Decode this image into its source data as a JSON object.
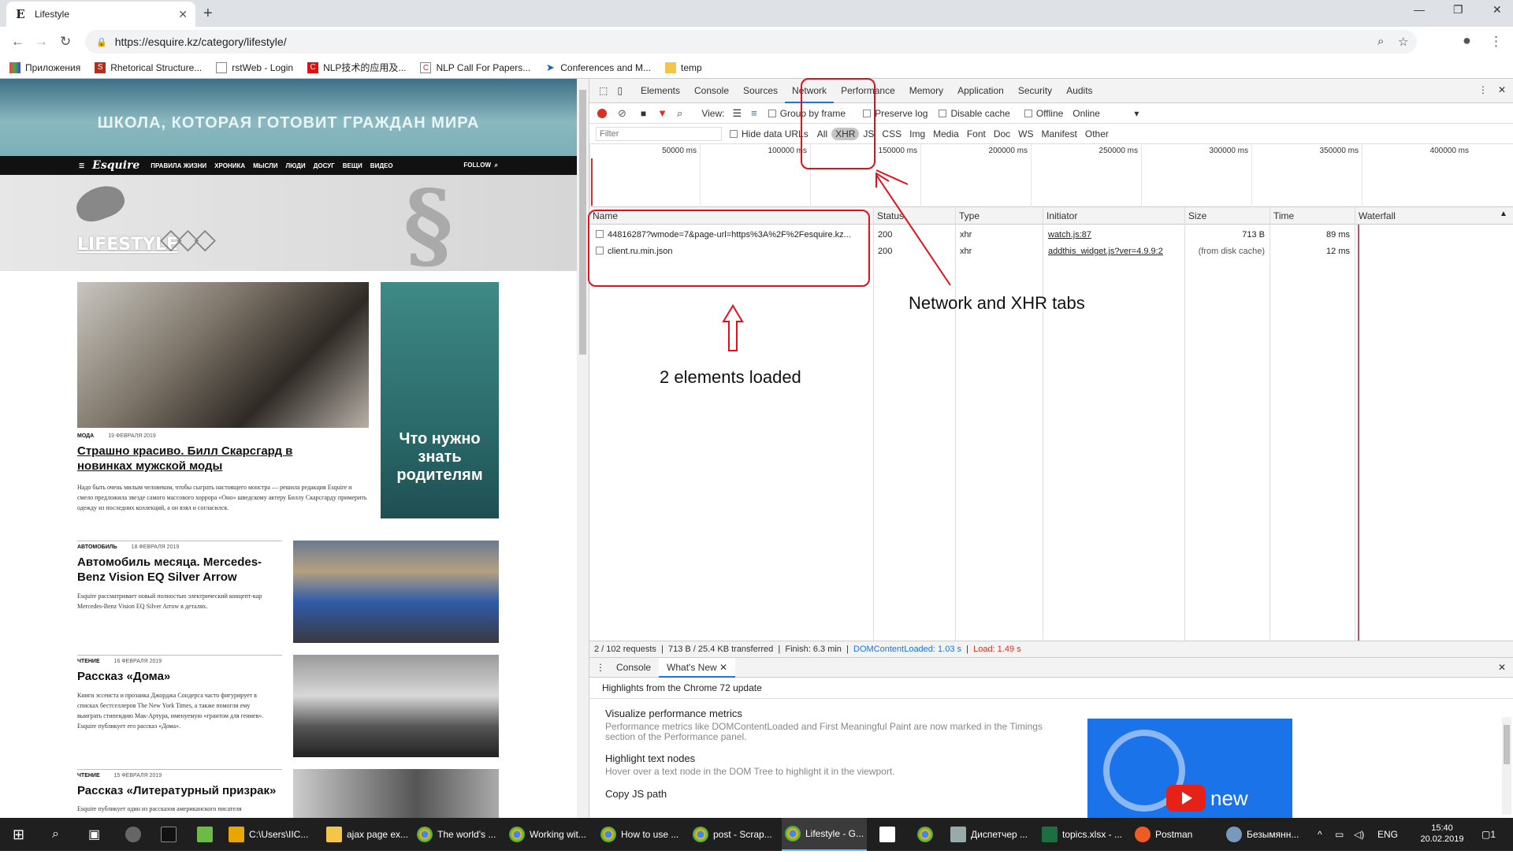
{
  "browser": {
    "tab_title": "Lifestyle",
    "tab_icon": "E",
    "url": "https://esquire.kz/category/lifestyle/",
    "bookmarks": [
      "Приложения",
      "Rhetorical Structure...",
      "rstWeb - Login",
      "NLP技术的应用及...",
      "NLP Call For Papers...",
      "Conferences and M...",
      "temp"
    ]
  },
  "page": {
    "banner_text": "ШКОЛА, КОТОРАЯ ГОТОВИТ ГРАЖДАН МИРА",
    "nav_logo": "Esquire",
    "nav_items": [
      "ПРАВИЛА ЖИЗНИ",
      "ХРОНИКА",
      "МЫСЛИ",
      "ЛЮДИ",
      "ДОСУГ",
      "ВЕЩИ",
      "ВИДЕО"
    ],
    "follow": "FOLLOW",
    "section_title": "LIFESTYLE",
    "side_ad_text": "Что нужно знать родителям",
    "articles": [
      {
        "category": "МОДА",
        "date": "19 ФЕВРАЛЯ 2019",
        "title": "Страшно красиво. Билл Скарсгард в новинках мужской моды",
        "text": "Надо быть очень милым человеком, чтобы сыграть настоящего монстра — решила редакция Esquire и смело предложила звезде самого массового хоррора «Оно» шведскому актеру Биллу Скарсгарду примерить одежду из последних коллекций, а он взял и согласился."
      },
      {
        "category": "АВТОМОБИЛЬ",
        "date": "18 ФЕВРАЛЯ 2019",
        "title": "Автомобиль месяца. Mercedes-Benz Vision EQ Silver Arrow",
        "text": "Esquire рассматривает новый полностью электрический концепт-кар Mercedes-Benz Vision EQ Silver Arrow в деталях."
      },
      {
        "category": "ЧТЕНИЕ",
        "date": "16 ФЕВРАЛЯ 2019",
        "title": "Рассказ «Дома»",
        "text": "Книги эссеиста и прозаика Джорджа Сондерса часто фигурирует в списках бестселлеров The New York Times, а также помогли ему выиграть стипендию Мак-Артура, именуемую «грантом для гениев». Esquire публикует его рассказ «Дома»."
      },
      {
        "category": "ЧТЕНИЕ",
        "date": "15 ФЕВРАЛЯ 2019",
        "title": "Рассказ «Литературный призрак»",
        "text": "Esquire публикует один из рассказов американского писателя"
      }
    ]
  },
  "devtools": {
    "tabs": [
      "Elements",
      "Console",
      "Sources",
      "Network",
      "Performance",
      "Memory",
      "Application",
      "Security",
      "Audits"
    ],
    "active_tab": "Network",
    "toolbar": {
      "view": "View:",
      "group_by_frame": "Group by frame",
      "preserve_log": "Preserve log",
      "disable_cache": "Disable cache",
      "offline": "Offline",
      "throttle": "Online"
    },
    "filter": {
      "placeholder": "Filter",
      "hide_data_urls": "Hide data URLs",
      "types": [
        "All",
        "XHR",
        "JS",
        "CSS",
        "Img",
        "Media",
        "Font",
        "Doc",
        "WS",
        "Manifest",
        "Other"
      ],
      "selected": "XHR"
    },
    "timeline_ticks": [
      "50000 ms",
      "100000 ms",
      "150000 ms",
      "200000 ms",
      "250000 ms",
      "300000 ms",
      "350000 ms",
      "400000 ms"
    ],
    "columns": [
      "Name",
      "Status",
      "Type",
      "Initiator",
      "Size",
      "Time",
      "Waterfall"
    ],
    "rows": [
      {
        "name": "44816287?wmode=7&page-url=https%3A%2F%2Fesquire.kz...",
        "status": "200",
        "type": "xhr",
        "initiator": "watch.js:87",
        "size": "713 B",
        "time": "89 ms"
      },
      {
        "name": "client.ru.min.json",
        "status": "200",
        "type": "xhr",
        "initiator": "addthis_widget.js?ver=4.9.9:2",
        "size": "(from disk cache)",
        "time": "12 ms"
      }
    ],
    "status": {
      "requests": "2 / 102 requests",
      "transferred": "713 B / 25.4 KB transferred",
      "finish": "Finish: 6.3 min",
      "dcl": "DOMContentLoaded: 1.03 s",
      "load": "Load: 1.49 s"
    },
    "drawer_tabs": [
      "Console",
      "What's New"
    ],
    "whats_new": {
      "heading": "Highlights from the Chrome 72 update",
      "items": [
        {
          "title": "Visualize performance metrics",
          "desc": "Performance metrics like DOMContentLoaded and First Meaningful Paint are now marked in the Timings section of the Performance panel."
        },
        {
          "title": "Highlight text nodes",
          "desc": "Hover over a text node in the DOM Tree to highlight it in the viewport."
        },
        {
          "title": "Copy JS path",
          "desc": ""
        }
      ],
      "video_text": "new"
    }
  },
  "annotations": {
    "network_label": "Network and XHR tabs",
    "loaded_label": "2 elements loaded",
    "color": "#e3101a"
  },
  "taskbar": {
    "items": [
      "C:\\Users\\IIC...",
      "ajax page ex...",
      "The world's ...",
      "Working wit...",
      "How to use ...",
      "post - Scrap...",
      "Lifestyle - G...",
      "Диспетчер ...",
      "topics.xlsx - ...",
      "Postman",
      "Безымянн..."
    ],
    "lang": "ENG",
    "time": "15:40",
    "date": "20.02.2019",
    "notif": "1"
  }
}
